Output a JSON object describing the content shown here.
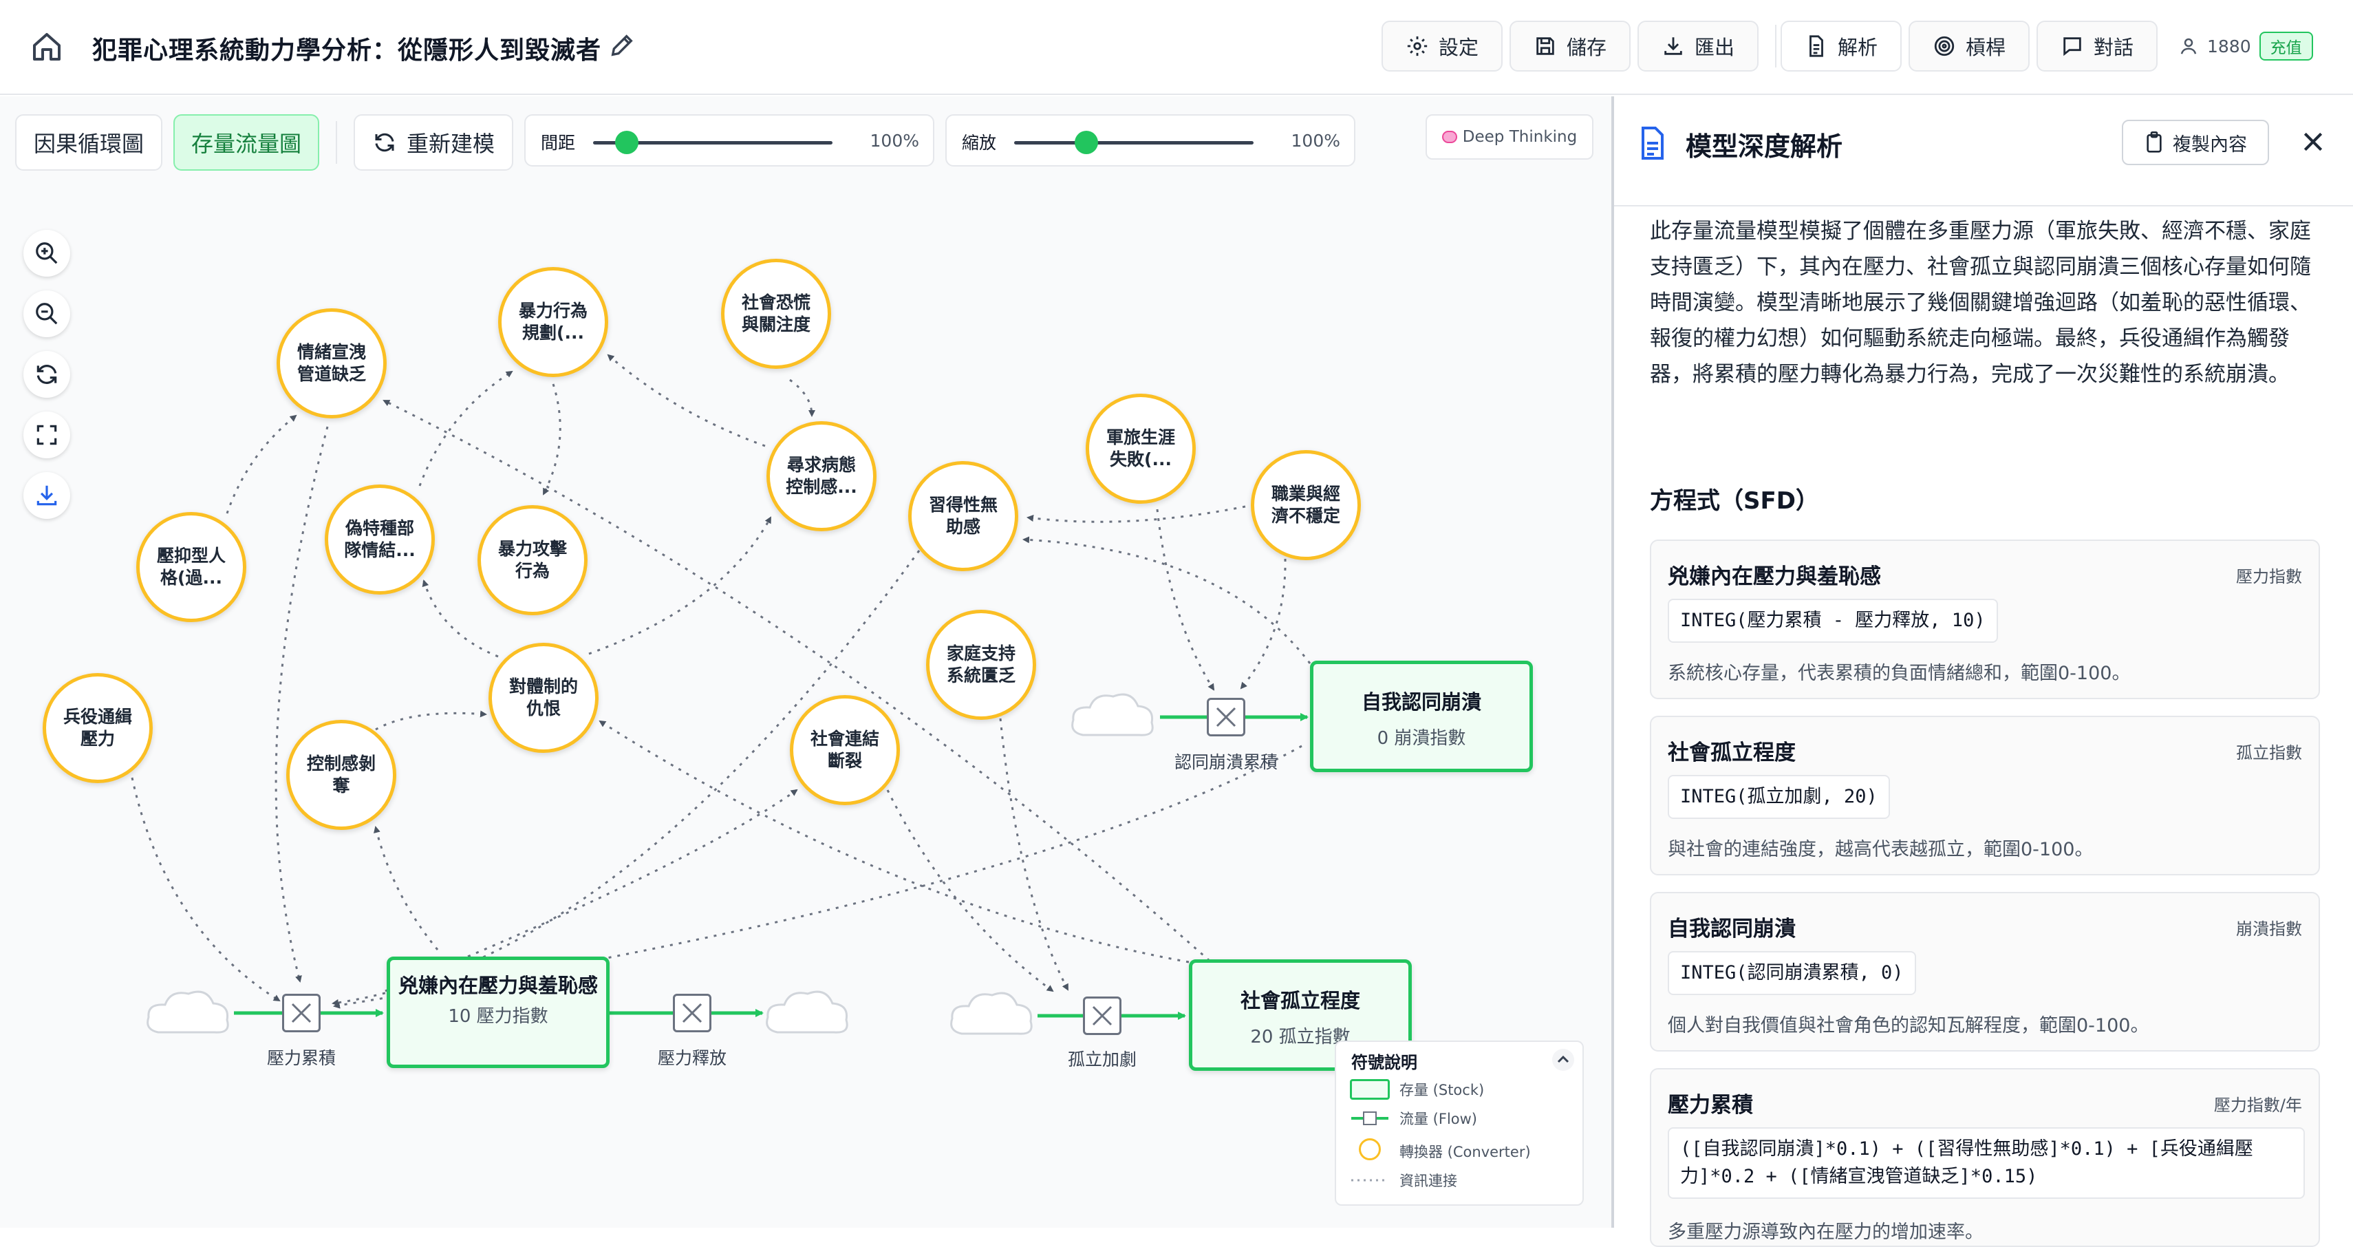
{
  "header": {
    "title": "犯罪心理系統動力學分析：從隱形人到毀滅者",
    "buttons": [
      {
        "label": "設定",
        "icon": "gear-icon"
      },
      {
        "label": "儲存",
        "icon": "save-icon"
      },
      {
        "label": "匯出",
        "icon": "download-icon"
      },
      {
        "label": "解析",
        "icon": "document-icon"
      },
      {
        "label": "槓桿",
        "icon": "target-icon"
      },
      {
        "label": "對話",
        "icon": "chat-icon"
      }
    ],
    "credits": "1880",
    "recharge_label": "充值"
  },
  "canvas": {
    "tabs": [
      {
        "label": "因果循環圖"
      },
      {
        "label": "存量流量圖"
      }
    ],
    "rebuild_label": "重新建模",
    "spacing": {
      "label": "間距",
      "value": "100%"
    },
    "zoom": {
      "label": "縮放",
      "value": "100%"
    },
    "deep_thinking_label": "Deep Thinking"
  },
  "diagram": {
    "converters": [
      {
        "label": "情緒宣洩管道缺乏"
      },
      {
        "label": "暴力行為規劃(..."
      },
      {
        "label": "社會恐慌與關注度"
      },
      {
        "label": "尋求病態控制感..."
      },
      {
        "label": "習得性無助感"
      },
      {
        "label": "軍旅生涯失敗(..."
      },
      {
        "label": "職業與經濟不穩定"
      },
      {
        "label": "壓抑型人格(過..."
      },
      {
        "label": "偽特種部隊情結..."
      },
      {
        "label": "暴力攻擊行為"
      },
      {
        "label": "對體制的仇恨"
      },
      {
        "label": "家庭支持系統匱乏"
      },
      {
        "label": "兵役通緝壓力"
      },
      {
        "label": "控制感剝奪"
      },
      {
        "label": "社會連結斷裂"
      }
    ],
    "stocks": [
      {
        "label": "兇嫌內在壓力與羞恥感",
        "value": "10 壓力指數"
      },
      {
        "label": "社會孤立程度",
        "value": "20 孤立指數"
      },
      {
        "label": "自我認同崩潰",
        "value": "0 崩潰指數"
      }
    ],
    "flows": [
      {
        "label": "壓力累積"
      },
      {
        "label": "壓力釋放"
      },
      {
        "label": "孤立加劇"
      },
      {
        "label": "認同崩潰累積"
      }
    ],
    "legend": {
      "title": "符號說明",
      "items": [
        {
          "label": "存量 (Stock)"
        },
        {
          "label": "流量 (Flow)"
        },
        {
          "label": "轉換器 (Converter)"
        },
        {
          "label": "資訊連接"
        }
      ]
    },
    "colors": {
      "stock": "#22c55e",
      "converter": "#fbbf24",
      "flow": "#22c55e",
      "link": "#6b7280"
    }
  },
  "panel": {
    "title": "模型深度解析",
    "copy_label": "複製內容",
    "description": "此存量流量模型模擬了個體在多重壓力源（軍旅失敗、經濟不穩、家庭支持匱乏）下，其內在壓力、社會孤立與認同崩潰三個核心存量如何隨時間演變。模型清晰地展示了幾個關鍵增強迴路（如羞恥的惡性循環、報復的權力幻想）如何驅動系統走向極端。最終，兵役通緝作為觸發器，將累積的壓力轉化為暴力行為，完成了一次災難性的系統崩潰。",
    "equations_heading": "方程式（SFD）",
    "equations": [
      {
        "name": "兇嫌內在壓力與羞恥感",
        "unit": "壓力指數",
        "formula": "INTEG(壓力累積 - 壓力釋放, 10)",
        "desc": "系統核心存量，代表累積的負面情緒總和，範圍0-100。"
      },
      {
        "name": "社會孤立程度",
        "unit": "孤立指數",
        "formula": "INTEG(孤立加劇, 20)",
        "desc": "與社會的連結強度，越高代表越孤立，範圍0-100。"
      },
      {
        "name": "自我認同崩潰",
        "unit": "崩潰指數",
        "formula": "INTEG(認同崩潰累積, 0)",
        "desc": "個人對自我價值與社會角色的認知瓦解程度，範圍0-100。"
      },
      {
        "name": "壓力累積",
        "unit": "壓力指數/年",
        "formula": "([自我認同崩潰]*0.1) + ([習得性無助感]*0.1) + [兵役通緝壓力]*0.2 + ([情緒宣洩管道缺乏]*0.15)",
        "desc": "多重壓力源導致內在壓力的增加速率。"
      }
    ]
  }
}
